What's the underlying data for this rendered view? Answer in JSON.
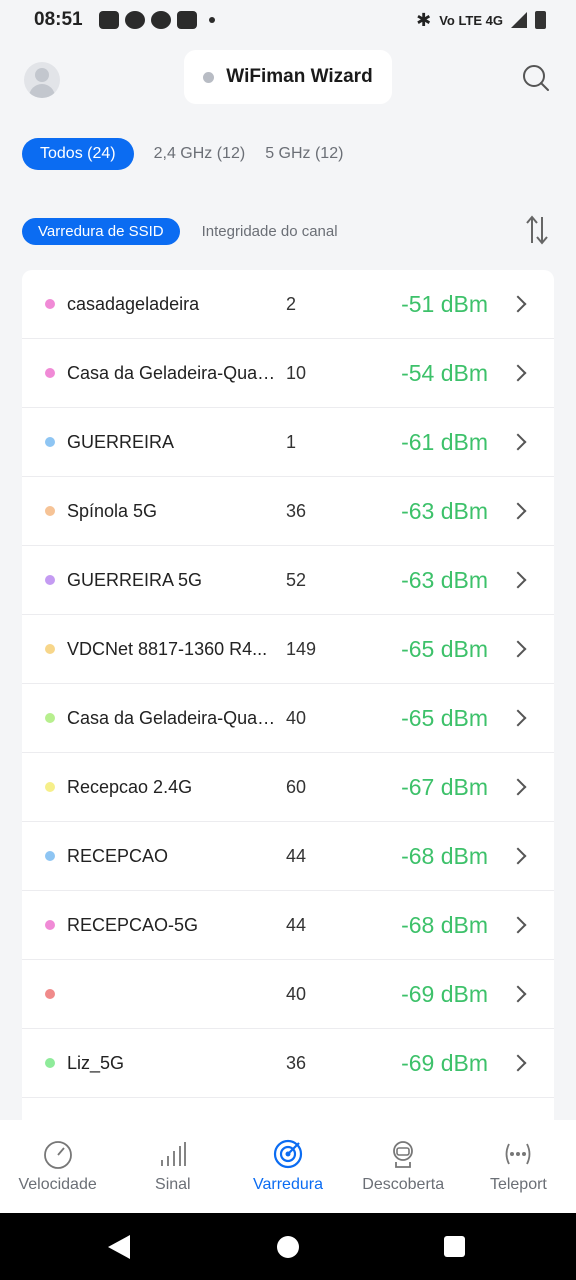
{
  "status_bar": {
    "time": "08:51",
    "network_label": "Vo LTE 4G"
  },
  "header": {
    "title": "WiFiman Wizard"
  },
  "filters": [
    {
      "label": "Todos (24)",
      "active": true
    },
    {
      "label": "2,4 GHz (12)",
      "active": false
    },
    {
      "label": "5 GHz (12)",
      "active": false
    }
  ],
  "subtabs": [
    {
      "label": "Varredura de SSID",
      "active": true
    },
    {
      "label": "Integridade do canal",
      "active": false
    }
  ],
  "networks": [
    {
      "ssid": "casadageladeira",
      "channel": "2",
      "signal": "-51 dBm",
      "color": "#f08ad6"
    },
    {
      "ssid": "Casa da Geladeira-Quali...",
      "channel": "10",
      "signal": "-54 dBm",
      "color": "#f08ad6"
    },
    {
      "ssid": "GUERREIRA",
      "channel": "1",
      "signal": "-61 dBm",
      "color": "#8ec5f3"
    },
    {
      "ssid": "Spínola 5G",
      "channel": "36",
      "signal": "-63 dBm",
      "color": "#f6c396"
    },
    {
      "ssid": "GUERREIRA 5G",
      "channel": "52",
      "signal": "-63 dBm",
      "color": "#c49bf2"
    },
    {
      "ssid": "VDCNet 8817-1360 R4...",
      "channel": "149",
      "signal": "-65 dBm",
      "color": "#f7d68a"
    },
    {
      "ssid": "Casa da Geladeira-Quali...",
      "channel": "40",
      "signal": "-65 dBm",
      "color": "#b7ef8e"
    },
    {
      "ssid": "Recepcao 2.4G",
      "channel": "60",
      "signal": "-67 dBm",
      "color": "#f6ef8a"
    },
    {
      "ssid": "RECEPCAO",
      "channel": "44",
      "signal": "-68 dBm",
      "color": "#8ec5f3"
    },
    {
      "ssid": "RECEPCAO-5G",
      "channel": "44",
      "signal": "-68 dBm",
      "color": "#f08ad6"
    },
    {
      "ssid": "",
      "channel": "40",
      "signal": "-69 dBm",
      "color": "#f08a8a"
    },
    {
      "ssid": "Liz_5G",
      "channel": "36",
      "signal": "-69 dBm",
      "color": "#8eeb9a"
    }
  ],
  "bottom_nav": [
    {
      "label": "Velocidade",
      "icon": "speedometer-icon",
      "active": false
    },
    {
      "label": "Sinal",
      "icon": "signal-bars-icon",
      "active": false
    },
    {
      "label": "Varredura",
      "icon": "radar-scan-icon",
      "active": true
    },
    {
      "label": "Descoberta",
      "icon": "discovery-icon",
      "active": false
    },
    {
      "label": "Teleport",
      "icon": "teleport-icon",
      "active": false
    }
  ],
  "colors": {
    "accent": "#0b6cf2",
    "signal_good": "#3dc16a"
  }
}
